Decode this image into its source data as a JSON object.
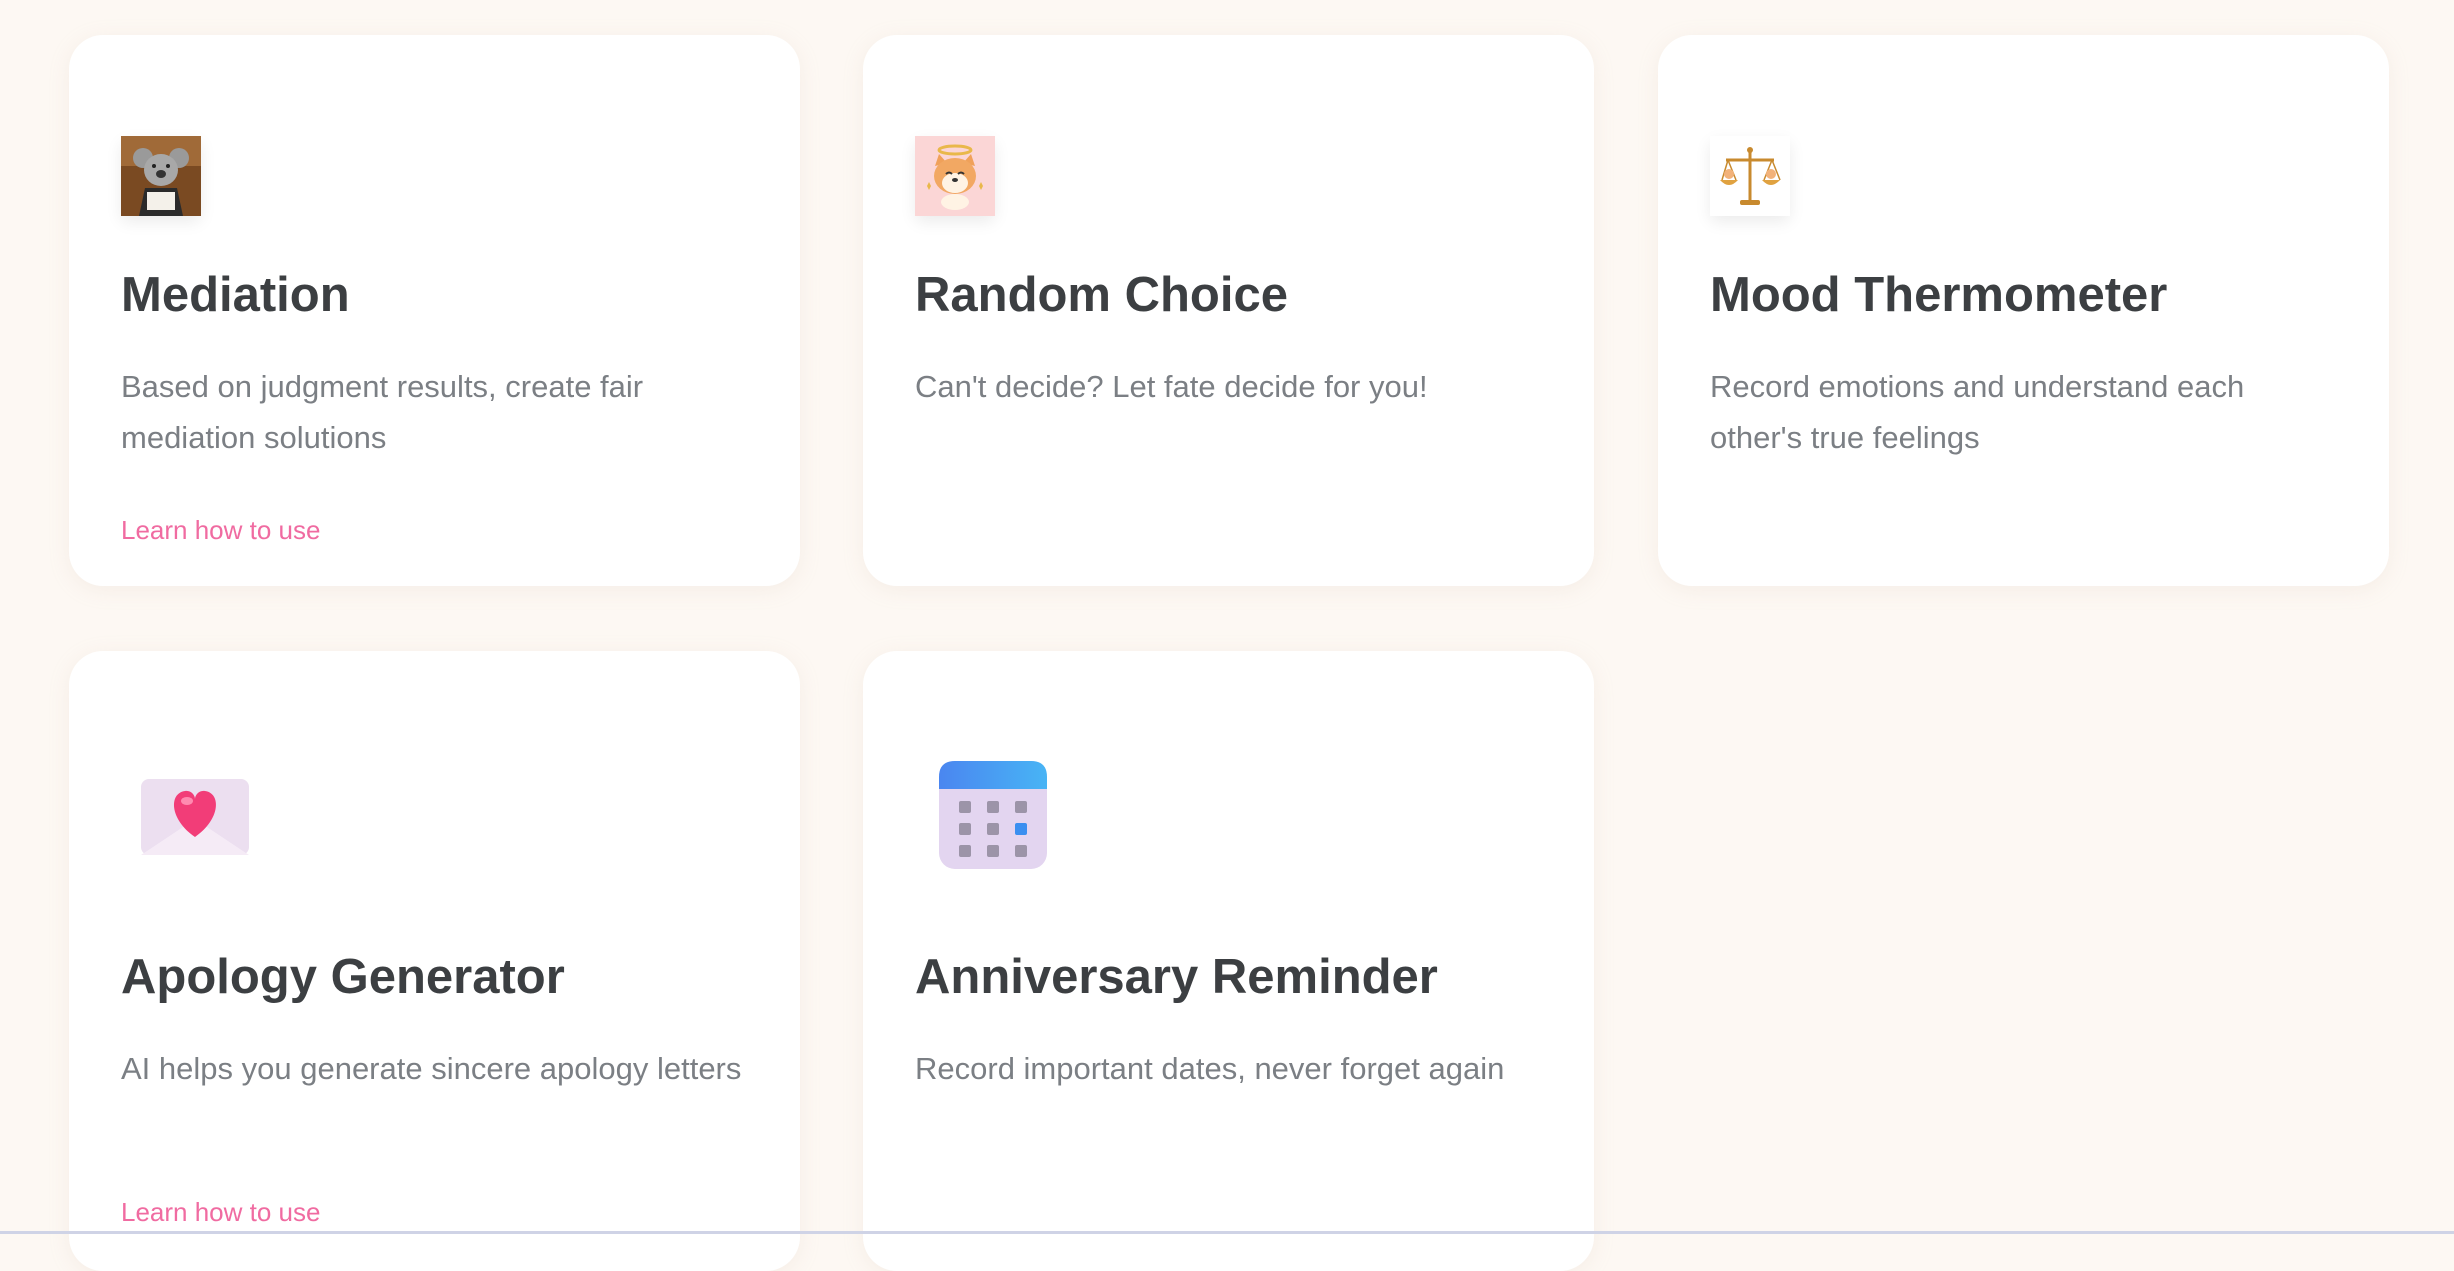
{
  "cards": [
    {
      "title": "Mediation",
      "description": "Based on judgment results, create fair mediation solutions",
      "link": "Learn how to use",
      "icon": "koala-judge-icon"
    },
    {
      "title": "Random Choice",
      "description": "Can't decide? Let fate decide for you!",
      "icon": "angel-shiba-icon"
    },
    {
      "title": "Mood Thermometer",
      "description": "Record emotions and understand each other's true feelings",
      "icon": "scales-icon"
    },
    {
      "title": "Apology Generator",
      "description": "AI helps you generate sincere apology letters",
      "link": "Learn how to use",
      "icon": "love-letter-icon"
    },
    {
      "title": "Anniversary Reminder",
      "description": "Record important dates, never forget again",
      "icon": "calendar-icon"
    }
  ],
  "colors": {
    "background": "#fdf8f3",
    "card": "#ffffff",
    "title": "#3c3f42",
    "description": "#7b7f84",
    "link": "#f06ba1"
  }
}
